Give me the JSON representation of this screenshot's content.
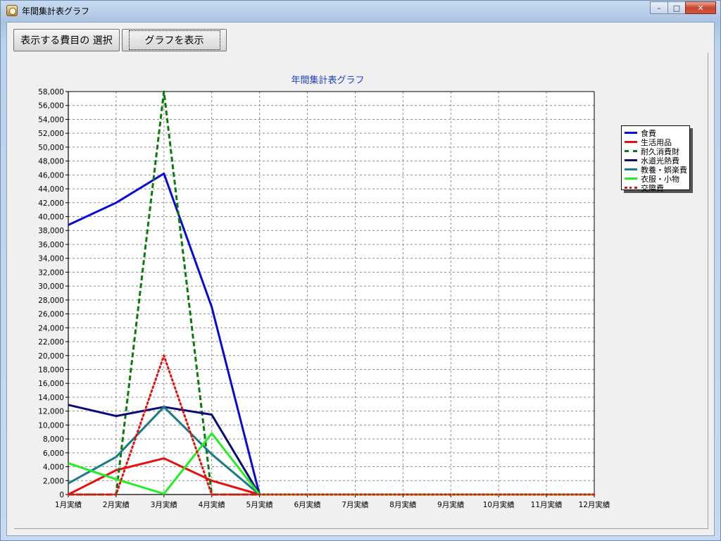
{
  "window": {
    "title": "年間集計表グラフ",
    "controls": {
      "minimize": "–",
      "maximize": "□",
      "close": "✕"
    }
  },
  "toolbar": {
    "select_items_label": "表示する費目の 選択",
    "show_graph_label": "グラフを表示"
  },
  "chart_data": {
    "type": "line",
    "title": "年間集計表グラフ",
    "xlabel": "",
    "ylabel": "",
    "categories": [
      "1月実績",
      "2月実績",
      "3月実績",
      "4月実績",
      "5月実績",
      "6月実績",
      "7月実績",
      "8月実績",
      "9月実績",
      "10月実績",
      "11月実績",
      "12月実績"
    ],
    "ylim": [
      0,
      58000
    ],
    "ytick_step": 2000,
    "grid": true,
    "legend_position": "top-right",
    "series": [
      {
        "name": "食費",
        "color": "#0a0ad2",
        "style": "solid",
        "values": [
          38800,
          42000,
          46200,
          27000,
          0,
          0,
          0,
          0,
          0,
          0,
          0,
          0
        ]
      },
      {
        "name": "生活用品",
        "color": "#e61010",
        "style": "solid",
        "values": [
          0,
          3500,
          5200,
          2000,
          0,
          0,
          0,
          0,
          0,
          0,
          0,
          0
        ]
      },
      {
        "name": "耐久消費財",
        "color": "#0a7a0a",
        "style": "dashed",
        "values": [
          0,
          0,
          58000,
          0,
          0,
          0,
          0,
          0,
          0,
          0,
          0,
          0
        ]
      },
      {
        "name": "水道光熱費",
        "color": "#0a0a78",
        "style": "solid",
        "values": [
          12900,
          11300,
          12600,
          11500,
          0,
          0,
          0,
          0,
          0,
          0,
          0,
          0
        ]
      },
      {
        "name": "教養・娯楽費",
        "color": "#1a7a86",
        "style": "solid",
        "values": [
          1600,
          5400,
          12600,
          5800,
          0,
          0,
          0,
          0,
          0,
          0,
          0,
          0
        ]
      },
      {
        "name": "衣服・小物",
        "color": "#22ee22",
        "style": "solid",
        "values": [
          4500,
          2200,
          100,
          8800,
          0,
          0,
          0,
          0,
          0,
          0,
          0,
          0
        ]
      },
      {
        "name": "交際費",
        "color": "#e61010",
        "style": "dotted",
        "values": [
          0,
          0,
          20000,
          0,
          0,
          0,
          0,
          0,
          0,
          0,
          0,
          0
        ]
      }
    ]
  }
}
